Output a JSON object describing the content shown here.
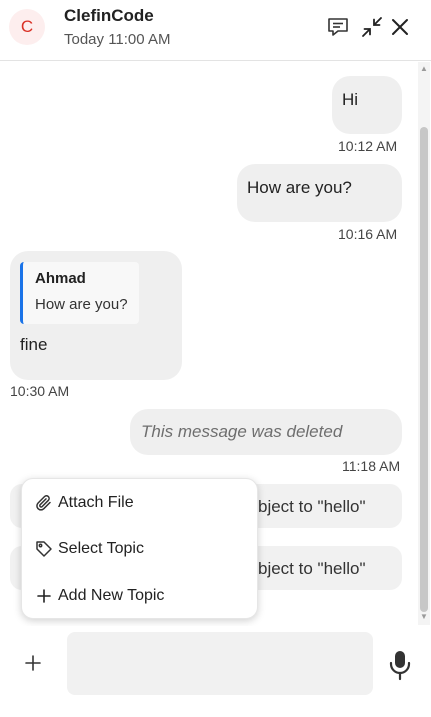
{
  "header": {
    "avatar_letter": "C",
    "title": "ClefinCode",
    "subtitle": "Today 11:00 AM",
    "icons": [
      "chat-topics-icon",
      "collapse-icon",
      "close-icon"
    ]
  },
  "messages": [
    {
      "text": "Hi",
      "time": "10:12 AM",
      "side": "right"
    },
    {
      "text": "How are you?",
      "time": "10:16 AM",
      "side": "right"
    },
    {
      "quote_name": "Ahmad",
      "quote_text": "How are you?",
      "text": "fine",
      "time": "10:30 AM",
      "side": "left"
    },
    {
      "text": "This message was deleted",
      "time": "11:18 AM",
      "side": "right",
      "deleted": true
    }
  ],
  "background_messages": [
    {
      "text": "bject to \"hello\""
    },
    {
      "text": "bject to \"hello\""
    }
  ],
  "menu": {
    "items": [
      {
        "label": "Attach File",
        "icon": "paperclip-icon"
      },
      {
        "label": "Select Topic",
        "icon": "tag-icon"
      },
      {
        "label": "Add New Topic",
        "icon": "plus-icon"
      }
    ]
  },
  "composer": {
    "input_value": "",
    "input_placeholder": ""
  },
  "colors": {
    "accent": "#1a73e8",
    "avatar_text": "#d93025",
    "avatar_bg": "#fdeeee",
    "bubble_bg": "#efefef"
  }
}
